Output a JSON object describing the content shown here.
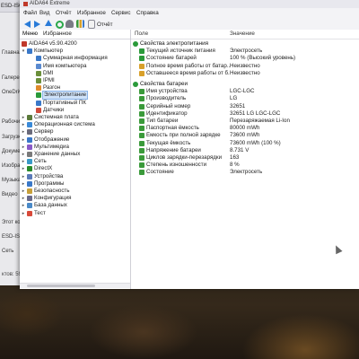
{
  "bg_explorer": {
    "title": "ESD-ISO | D",
    "items": [
      "Главная",
      "Галерея",
      "OneDriv",
      "Рабочий",
      "Загрузк",
      "Докуме",
      "Изобра",
      "Музыка",
      "Видео",
      "Этот ко",
      "ESD-ISO",
      "Сеть"
    ],
    "status": "ктов: 59"
  },
  "window": {
    "title": "AIDA64 Extreme"
  },
  "menu": [
    "Файл",
    "Вид",
    "Отчёт",
    "Избранное",
    "Сервис",
    "Справка"
  ],
  "toolbar": {
    "report_label": "Отчёт"
  },
  "left_tabs": [
    "Меню",
    "Избранное"
  ],
  "tree": [
    {
      "label": "AIDA64 v5.90.4200",
      "icon": "aida-icon",
      "color": "#c0392b",
      "depth": 0,
      "toggle": ""
    },
    {
      "label": "Компьютер",
      "icon": "computer-icon",
      "color": "#3a78c8",
      "depth": 1,
      "toggle": "v"
    },
    {
      "label": "Суммарная информация",
      "icon": "info-icon",
      "color": "#3a78c8",
      "depth": 2,
      "toggle": ""
    },
    {
      "label": "Имя компьютера",
      "icon": "computer-icon",
      "color": "#5a8ad0",
      "depth": 2,
      "toggle": ""
    },
    {
      "label": "DMI",
      "icon": "chip-icon",
      "color": "#6b8f3a",
      "depth": 2,
      "toggle": ""
    },
    {
      "label": "IPMI",
      "icon": "chip-icon",
      "color": "#6b8f3a",
      "depth": 2,
      "toggle": ""
    },
    {
      "label": "Разгон",
      "icon": "flame-icon",
      "color": "#e08a2a",
      "depth": 2,
      "toggle": ""
    },
    {
      "label": "Электропитание",
      "icon": "power-icon",
      "color": "#2a9a3a",
      "depth": 2,
      "toggle": "",
      "selected": true
    },
    {
      "label": "Портативный ПК",
      "icon": "laptop-icon",
      "color": "#3a78c8",
      "depth": 2,
      "toggle": ""
    },
    {
      "label": "Датчики",
      "icon": "sensor-icon",
      "color": "#d04a3a",
      "depth": 2,
      "toggle": ""
    },
    {
      "label": "Системная плата",
      "icon": "motherboard-icon",
      "color": "#5a7a3a",
      "depth": 1,
      "toggle": ">"
    },
    {
      "label": "Операционная система",
      "icon": "windows-icon",
      "color": "#3a8ad8",
      "depth": 1,
      "toggle": ">"
    },
    {
      "label": "Сервер",
      "icon": "server-icon",
      "color": "#6a6a7a",
      "depth": 1,
      "toggle": ">"
    },
    {
      "label": "Отображение",
      "icon": "display-icon",
      "color": "#3a78c8",
      "depth": 1,
      "toggle": ">"
    },
    {
      "label": "Мультимедиа",
      "icon": "multimedia-icon",
      "color": "#8a5ac8",
      "depth": 1,
      "toggle": ">"
    },
    {
      "label": "Хранение данных",
      "icon": "storage-icon",
      "color": "#7a7a7a",
      "depth": 1,
      "toggle": ">"
    },
    {
      "label": "Сеть",
      "icon": "network-icon",
      "color": "#3a9ac8",
      "depth": 1,
      "toggle": ">"
    },
    {
      "label": "DirectX",
      "icon": "directx-icon",
      "color": "#2a8a2a",
      "depth": 1,
      "toggle": ">"
    },
    {
      "label": "Устройства",
      "icon": "devices-icon",
      "color": "#5a7ab8",
      "depth": 1,
      "toggle": ">"
    },
    {
      "label": "Программы",
      "icon": "programs-icon",
      "color": "#3a78c8",
      "depth": 1,
      "toggle": ">"
    },
    {
      "label": "Безопасность",
      "icon": "security-icon",
      "color": "#c8a03a",
      "depth": 1,
      "toggle": ">"
    },
    {
      "label": "Конфигурация",
      "icon": "config-icon",
      "color": "#6a6a8a",
      "depth": 1,
      "toggle": ">"
    },
    {
      "label": "База данных",
      "icon": "database-icon",
      "color": "#4a8ac8",
      "depth": 1,
      "toggle": ">"
    },
    {
      "label": "Тест",
      "icon": "test-icon",
      "color": "#d84a3a",
      "depth": 1,
      "toggle": ">"
    }
  ],
  "columns": {
    "field": "Поле",
    "value": "Значение"
  },
  "groups": [
    {
      "title": "Свойства электропитания",
      "rows": [
        {
          "field": "Текущий источник питания",
          "value": "Электросеть"
        },
        {
          "field": "Состояние батарей",
          "value": "100 % (Высокий уровень)"
        },
        {
          "field": "Полное время работы от батар...",
          "value": "Неизвестно"
        },
        {
          "field": "Оставшееся время работы от б...",
          "value": "Неизвестно"
        }
      ]
    },
    {
      "title": "Свойства батареи",
      "rows": [
        {
          "field": "Имя устройства",
          "value": "LGC-LGC"
        },
        {
          "field": "Производитель",
          "value": "LG"
        },
        {
          "field": "Серийный номер",
          "value": "32651"
        },
        {
          "field": "Идентификатор",
          "value": "32651 LG LGC-LGC"
        },
        {
          "field": "Тип батареи",
          "value": "Перезаряжаемая Li-Ion"
        },
        {
          "field": "Паспортная ёмкость",
          "value": "80000 mWh"
        },
        {
          "field": "Ёмкость при полной зарядке",
          "value": "73600 mWh"
        },
        {
          "field": "Текущая ёмкость",
          "value": "73600 mWh  (100 %)"
        },
        {
          "field": "Напряжение батареи",
          "value": "8.731 V"
        },
        {
          "field": "Циклов зарядки-перезарядки",
          "value": "163"
        },
        {
          "field": "Степень изношенности",
          "value": "8 %"
        },
        {
          "field": "Состояние",
          "value": "Электросеть"
        }
      ]
    }
  ]
}
